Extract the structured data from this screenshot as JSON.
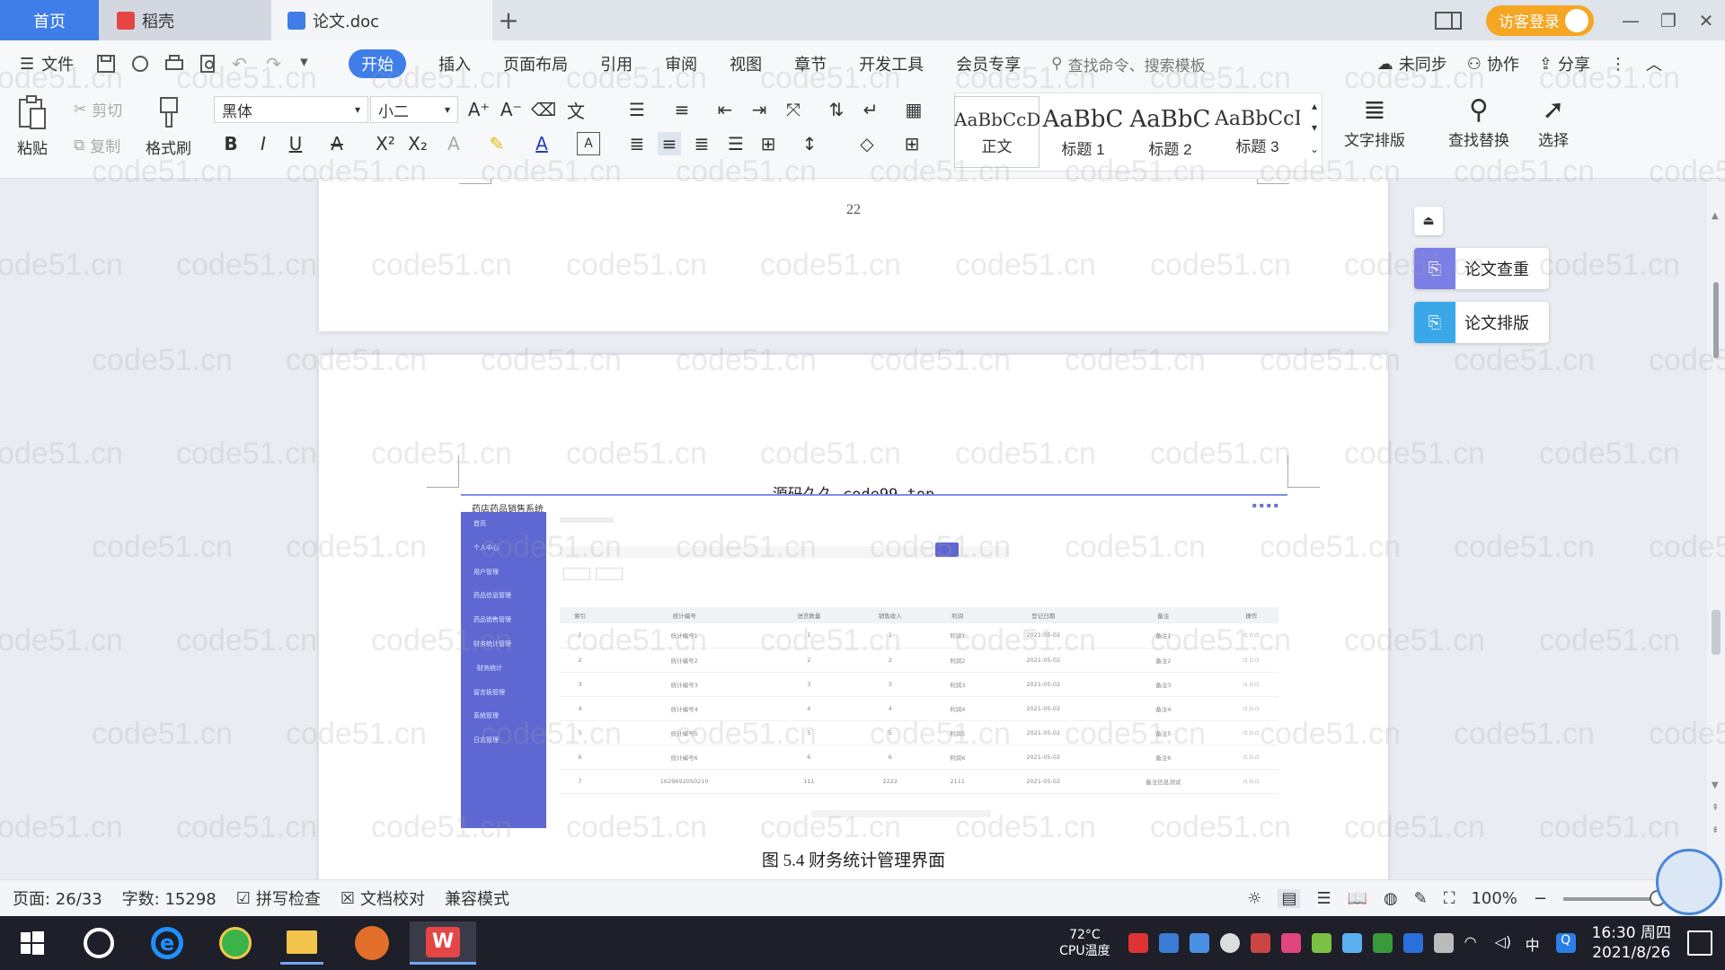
{
  "tabs": {
    "home": "首页",
    "daoke": "稻壳",
    "doc": "论文.doc"
  },
  "window": {
    "login": "访客登录"
  },
  "menu": {
    "file": "文件",
    "items": [
      "开始",
      "插入",
      "页面布局",
      "引用",
      "审阅",
      "视图",
      "章节",
      "开发工具",
      "会员专享"
    ],
    "search_placeholder": "查找命令、搜索模板",
    "sync": "未同步",
    "collab": "协作",
    "share": "分享"
  },
  "ribbon": {
    "paste": "粘贴",
    "cut": "剪切",
    "copy": "复制",
    "format_painter": "格式刷",
    "font_name": "黑体",
    "font_size": "小二",
    "styles": [
      {
        "preview": "AaBbCcDd",
        "name": "正文"
      },
      {
        "preview": "AaBbC",
        "name": "标题 1"
      },
      {
        "preview": "AaBbC",
        "name": "标题 2"
      },
      {
        "preview": "AaBbCcI",
        "name": "标题 3"
      }
    ],
    "text_layout": "文字排版",
    "find_replace": "查找替换",
    "select": "选择"
  },
  "document": {
    "page_number": "22",
    "header": "源码久久-code99.top",
    "caption": "图 5.4 财务统计管理界面",
    "screenshot": {
      "title": "药店药品销售系统",
      "sidebar": [
        "首页",
        "个人中心",
        "用户管理",
        "药品信息管理",
        "药品销售管理",
        "财务统计管理",
        "财务统计",
        "留言板管理",
        "系统管理",
        "日志管理"
      ],
      "columns": [
        "索引",
        "统计编号",
        "进货数量",
        "销售收入",
        "利润",
        "登记日期",
        "备注",
        "操作"
      ],
      "rows": [
        [
          "1",
          "统计编号1",
          "1",
          "1",
          "利润1",
          "2021-05-02",
          "备注1"
        ],
        [
          "2",
          "统计编号2",
          "2",
          "2",
          "利润2",
          "2021-05-02",
          "备注2"
        ],
        [
          "3",
          "统计编号3",
          "3",
          "3",
          "利润3",
          "2021-05-02",
          "备注3"
        ],
        [
          "4",
          "统计编号4",
          "4",
          "4",
          "利润4",
          "2021-05-02",
          "备注4"
        ],
        [
          "5",
          "统计编号5",
          "5",
          "5",
          "利润5",
          "2021-05-02",
          "备注5"
        ],
        [
          "6",
          "统计编号6",
          "6",
          "6",
          "利润6",
          "2021-05-02",
          "备注6"
        ],
        [
          "7",
          "1629692050210",
          "111",
          "2222",
          "2111",
          "2021-05-02",
          "备注信息测试"
        ]
      ]
    }
  },
  "side_panel": {
    "check": "论文查重",
    "layout": "论文排版"
  },
  "status": {
    "page": "页面: 26/33",
    "words": "字数: 15298",
    "spell": "拼写检查",
    "proof": "文档校对",
    "compat": "兼容模式",
    "zoom": "100%"
  },
  "taskbar": {
    "temp": "72°C",
    "cpu": "CPU温度",
    "time": "16:30 周四",
    "date": "2021/8/26"
  },
  "watermark": "code51.cn"
}
